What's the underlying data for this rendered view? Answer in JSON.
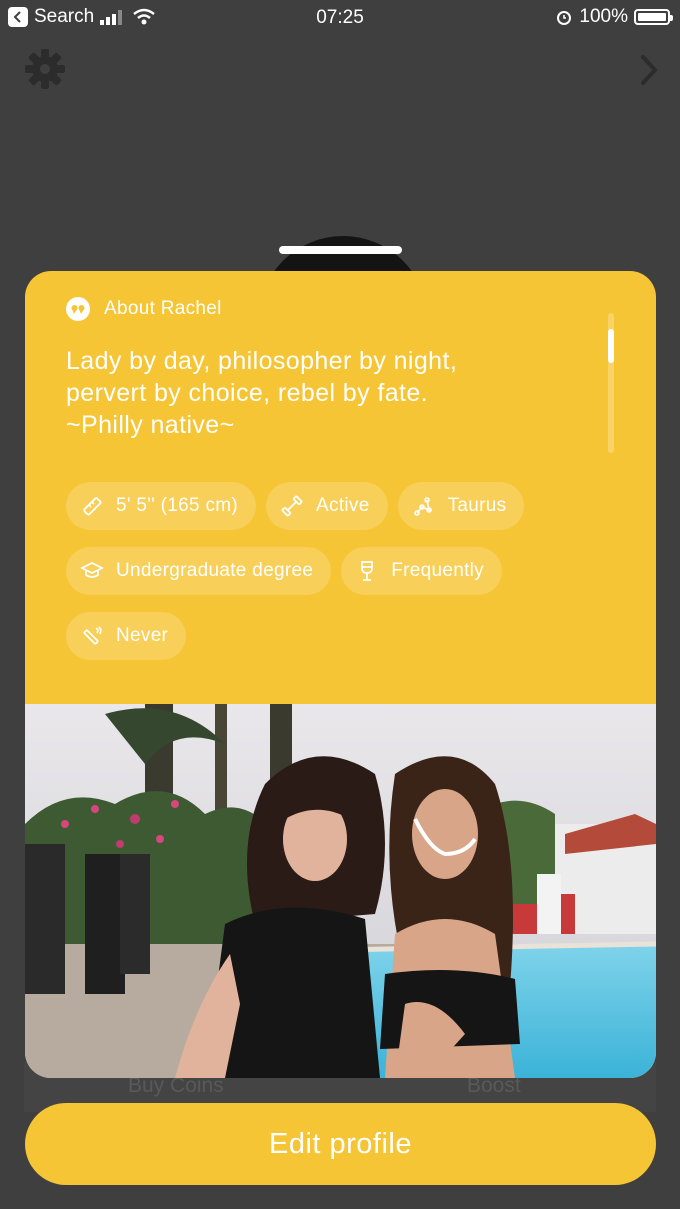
{
  "status_bar": {
    "back_app": "Search",
    "time": "07:25",
    "battery": "100%"
  },
  "behind": {
    "buy_coins": "Buy Coins",
    "boost": "Boost"
  },
  "card": {
    "about_title": "About Rachel",
    "bio": "Lady by day, philosopher by night,\npervert by choice, rebel by fate.\n~Philly native~",
    "chips": [
      {
        "icon": "ruler-icon",
        "label": "5' 5'' (165 cm)"
      },
      {
        "icon": "dumbbell-icon",
        "label": "Active"
      },
      {
        "icon": "constellation-icon",
        "label": "Taurus"
      },
      {
        "icon": "graduation-cap-icon",
        "label": "Undergraduate degree"
      },
      {
        "icon": "wine-glass-icon",
        "label": "Frequently"
      },
      {
        "icon": "cigarette-icon",
        "label": "Never"
      }
    ]
  },
  "edit_button": "Edit profile",
  "colors": {
    "accent": "#f6c535",
    "background": "#3f3f3f"
  }
}
